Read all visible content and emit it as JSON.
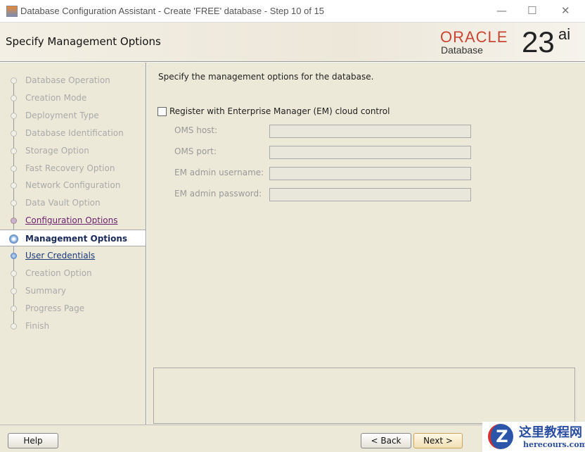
{
  "window": {
    "title": "Database Configuration Assistant - Create 'FREE' database - Step 10 of 15",
    "minimize": "—",
    "maximize": "☐",
    "close": "✕"
  },
  "header": {
    "title": "Specify Management Options",
    "logo_brand": "ORACLE",
    "logo_product": "Database",
    "logo_version": "23",
    "logo_suffix": "ai"
  },
  "steps": [
    {
      "label": "Database Operation",
      "state": "disabled"
    },
    {
      "label": "Creation Mode",
      "state": "disabled"
    },
    {
      "label": "Deployment Type",
      "state": "disabled"
    },
    {
      "label": "Database Identification",
      "state": "disabled"
    },
    {
      "label": "Storage Option",
      "state": "disabled"
    },
    {
      "label": "Fast Recovery Option",
      "state": "disabled"
    },
    {
      "label": "Network Configuration",
      "state": "disabled"
    },
    {
      "label": "Data Vault Option",
      "state": "disabled"
    },
    {
      "label": "Configuration Options",
      "state": "visited"
    },
    {
      "label": "Management Options",
      "state": "current"
    },
    {
      "label": "User Credentials",
      "state": "link"
    },
    {
      "label": "Creation Option",
      "state": "disabled"
    },
    {
      "label": "Summary",
      "state": "disabled"
    },
    {
      "label": "Progress Page",
      "state": "disabled"
    },
    {
      "label": "Finish",
      "state": "disabled"
    }
  ],
  "main": {
    "intro": "Specify the management options for the database.",
    "register_em": {
      "label": "Register with Enterprise Manager (EM) cloud control",
      "checked": false
    },
    "fields": [
      {
        "label": "OMS host:",
        "value": ""
      },
      {
        "label": "OMS port:",
        "value": ""
      },
      {
        "label": "EM admin username:",
        "value": ""
      },
      {
        "label": "EM admin password:",
        "value": ""
      }
    ]
  },
  "footer": {
    "help": "Help",
    "back": "< Back",
    "next": "Next >"
  },
  "watermark": {
    "cn": "这里教程网",
    "en": "herecours.com",
    "mark": "Z"
  }
}
